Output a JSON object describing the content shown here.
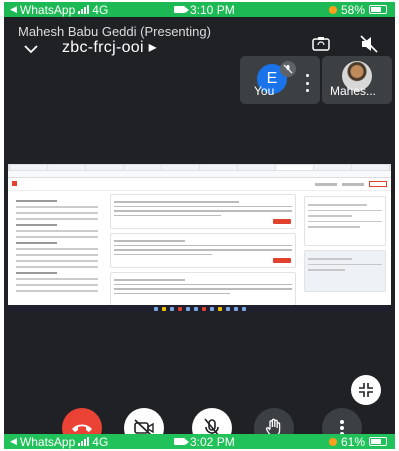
{
  "status_top": {
    "app": "WhatsApp",
    "network": "4G",
    "time": "3:10 PM",
    "battery": "58%"
  },
  "status_bottom": {
    "app": "WhatsApp",
    "network": "4G",
    "time": "3:02 PM",
    "battery": "61%"
  },
  "meeting": {
    "presenter_line": "Mahesh Babu Geddi (Presenting)",
    "code": "zbc-frcj-ooi ▸"
  },
  "participants": [
    {
      "avatar_letter": "E",
      "label": "You",
      "muted": true
    },
    {
      "label": "Mahes..."
    }
  ],
  "colors": {
    "status_green": "#1db954",
    "meet_bg": "#202124",
    "tile_bg": "#3c4043",
    "avatar_blue": "#1a73e8",
    "end_call_red": "#ea4335"
  },
  "icons": {
    "header": [
      "chevron-down-icon",
      "flip-camera-icon",
      "speaker-off-icon"
    ],
    "controls": [
      "end-call-icon",
      "camera-off-icon",
      "mic-off-icon",
      "raise-hand-icon",
      "more-options-icon"
    ],
    "fab": "collapse-icon"
  }
}
